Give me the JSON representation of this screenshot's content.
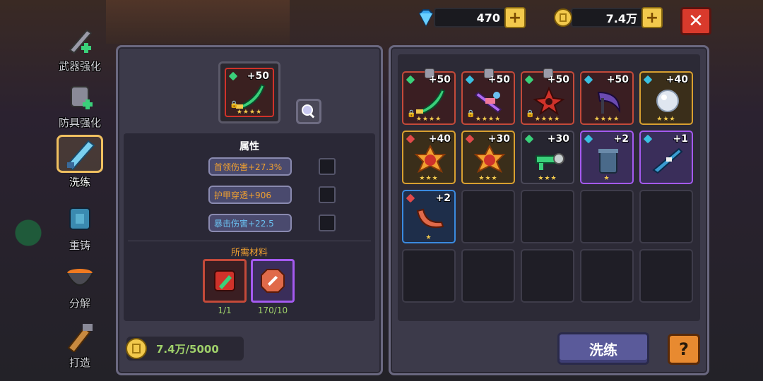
{
  "currencies": {
    "gems": {
      "value": "470",
      "icon": "diamond-icon",
      "color": "#39a8f0"
    },
    "gold": {
      "value": "7.4万",
      "icon": "gold-coin-icon",
      "color": "#f2c94c"
    }
  },
  "side_menu": [
    {
      "label": "武器强化",
      "icon": "sword-upgrade-icon",
      "active": false
    },
    {
      "label": "防具强化",
      "icon": "armor-upgrade-icon",
      "active": false
    },
    {
      "label": "洗练",
      "icon": "reforge-sword-icon",
      "active": true
    },
    {
      "label": "重铸",
      "icon": "recast-armor-icon",
      "active": false
    },
    {
      "label": "分解",
      "icon": "cauldron-icon",
      "active": false
    },
    {
      "label": "打造",
      "icon": "forge-hammer-icon",
      "active": false
    }
  ],
  "selected_item": {
    "level": "+50",
    "stars": "★★★★",
    "icon": "green-saber-icon"
  },
  "attributes": {
    "title": "属性",
    "rows": [
      {
        "text": "首领伤害+27.3%",
        "color": "#f0a030"
      },
      {
        "text": "护甲穿透+906",
        "color": "#f0a030"
      },
      {
        "text": "暴击伤害+22.5",
        "color": "#6ac0f0"
      }
    ]
  },
  "materials": {
    "title": "所需材料",
    "items": [
      {
        "icon": "red-weapon-scroll-icon",
        "count": "1/1",
        "border": "#c44a3a"
      },
      {
        "icon": "reforge-stone-icon",
        "count": "170/10",
        "border": "#a45af0"
      }
    ]
  },
  "cost": {
    "text": "7.4万/5000"
  },
  "inventory": [
    {
      "level": "+50",
      "stars": "★★★★",
      "rarity": "red",
      "gem": "#3ad07a",
      "lock": true,
      "pin": true,
      "icon": "green-saber-icon"
    },
    {
      "level": "+50",
      "stars": "★★★★",
      "rarity": "red",
      "gem": "#3ac0e0",
      "lock": true,
      "pin": true,
      "icon": "purple-crossbow-icon"
    },
    {
      "level": "+50",
      "stars": "★★★★",
      "rarity": "red",
      "gem": "#3ad07a",
      "lock": true,
      "pin": true,
      "icon": "red-shuriken-icon"
    },
    {
      "level": "+50",
      "stars": "★★★★",
      "rarity": "red",
      "gem": "#3ac0e0",
      "lock": false,
      "pin": false,
      "icon": "dark-scythe-icon"
    },
    {
      "level": "+40",
      "stars": "★★★",
      "rarity": "gold",
      "gem": "#3ac0e0",
      "lock": false,
      "pin": false,
      "icon": "frost-orb-icon"
    },
    {
      "level": "+40",
      "stars": "★★★",
      "rarity": "gold",
      "gem": "#e04a4a",
      "lock": false,
      "pin": false,
      "icon": "red-gem-flower-icon"
    },
    {
      "level": "+30",
      "stars": "★★★",
      "rarity": "gold",
      "gem": "#e04a4a",
      "lock": false,
      "pin": false,
      "icon": "red-gem-flower-icon"
    },
    {
      "level": "+30",
      "stars": "★★★",
      "rarity": "none",
      "gem": "#3ad07a",
      "lock": false,
      "pin": false,
      "icon": "green-gun-icon"
    },
    {
      "level": "+2",
      "stars": "★",
      "rarity": "purple",
      "gem": "#3ac0e0",
      "lock": false,
      "pin": false,
      "icon": "trash-bin-icon"
    },
    {
      "level": "+1",
      "stars": "",
      "rarity": "purple",
      "gem": "#3ac0e0",
      "lock": false,
      "pin": false,
      "icon": "blue-rifle-icon"
    },
    {
      "level": "+2",
      "stars": "★",
      "rarity": "blue",
      "gem": "#e04a4a",
      "lock": false,
      "pin": false,
      "icon": "boomerang-icon"
    }
  ],
  "inventory_slot_count": 20,
  "buttons": {
    "reforge_label": "洗练",
    "help_label": "?",
    "close_label": "✕",
    "plus_label": "+"
  }
}
